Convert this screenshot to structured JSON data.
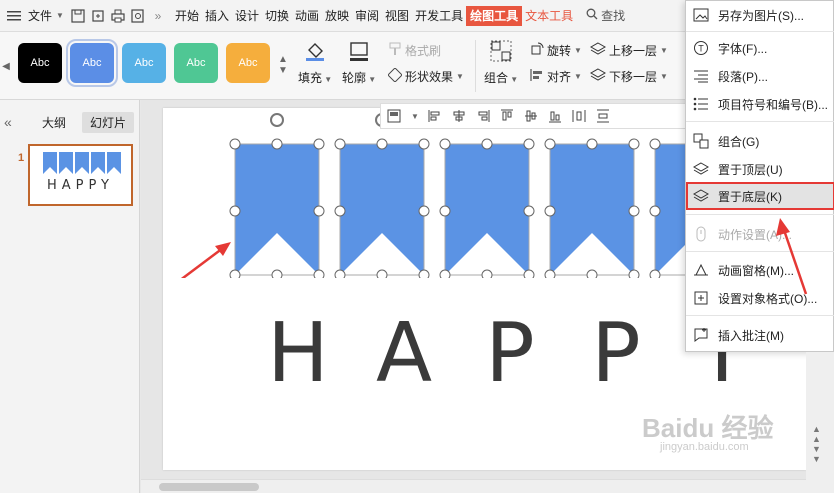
{
  "menubar": {
    "file_label": "文件",
    "tabs": [
      "开始",
      "插入",
      "设计",
      "切换",
      "动画",
      "放映",
      "审阅",
      "视图",
      "开发工具"
    ],
    "draw_tool": "绘图工具",
    "text_tool": "文本工具",
    "search": "查找"
  },
  "ribbon": {
    "style_label": "Abc",
    "style_colors": [
      "#000000",
      "#5b8ee6",
      "#56b1e6",
      "#4fc794",
      "#f5ae3d"
    ],
    "fill": "填充",
    "outline": "轮廓",
    "format_painter": "格式刷",
    "shape_effect": "形状效果",
    "group": "组合",
    "rotate": "旋转",
    "align": "对齐",
    "bring_forward": "上移一层",
    "send_backward": "下移一层"
  },
  "leftpanel": {
    "outline_tab": "大纲",
    "slides_tab": "幻灯片",
    "slide_number": "1",
    "thumb_text": "HAPPY"
  },
  "slide": {
    "letters": [
      "H",
      "A",
      "P",
      "P",
      "Y"
    ],
    "flag_color": "#5b93e4"
  },
  "context_menu": {
    "items": [
      {
        "label": "另存为图片(S)...",
        "icon": "image-save-icon"
      },
      {
        "label": "字体(F)...",
        "icon": "font-icon"
      },
      {
        "label": "段落(P)...",
        "icon": "paragraph-icon"
      },
      {
        "label": "项目符号和编号(B)...",
        "icon": "bullets-icon"
      },
      {
        "label": "组合(G)",
        "icon": "group-icon"
      },
      {
        "label": "置于顶层(U)",
        "icon": "layers-icon"
      },
      {
        "label": "置于底层(K)",
        "icon": "layers-icon"
      },
      {
        "label": "动作设置(A)...",
        "icon": "action-icon"
      },
      {
        "label": "动画窗格(M)...",
        "icon": "animation-icon"
      },
      {
        "label": "设置对象格式(O)...",
        "icon": "format-object-icon"
      },
      {
        "label": "插入批注(M)",
        "icon": "comment-icon"
      }
    ]
  },
  "watermark": {
    "brand": "Baidu 经验",
    "url": "jingyan.baidu.com"
  },
  "colors": {
    "accent": "#e8563f",
    "highlight_border": "#e53935",
    "annotation_arrow": "#e53935"
  }
}
